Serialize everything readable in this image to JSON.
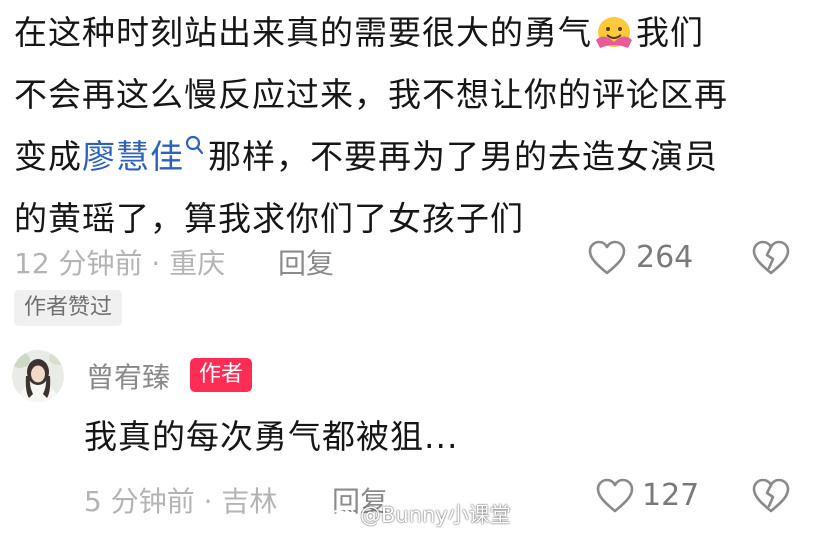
{
  "comment": {
    "lines": [
      "在这种时刻站出来真的需要很大的勇气",
      "我们",
      "不会再这么慢反应过来，我不想让你的评论区再",
      "变成",
      "廖慧佳",
      "那样，不要再为了男的去造女演员",
      "的黄瑶了，算我求你们了女孩子们"
    ],
    "time_location": "12 分钟前 · 重庆",
    "reply_label": "回复",
    "like_count": "264",
    "author_liked_badge": "作者赞过"
  },
  "reply": {
    "username": "曾宥臻",
    "author_tag": "作者",
    "text": "我真的每次勇气都被狙...",
    "time_location": "5 分钟前 · 吉林",
    "reply_label": "回复",
    "like_count": "127"
  },
  "watermark": {
    "text": "@Bunny小课堂"
  },
  "colors": {
    "mention": "#2e62b8",
    "author_tag_bg": "#ff2d55",
    "meta_text": "#b4b4b4"
  },
  "icons": [
    "hug-emoji",
    "search-icon",
    "heart-outline-icon",
    "broken-heart-icon",
    "weibo-logo-icon"
  ]
}
